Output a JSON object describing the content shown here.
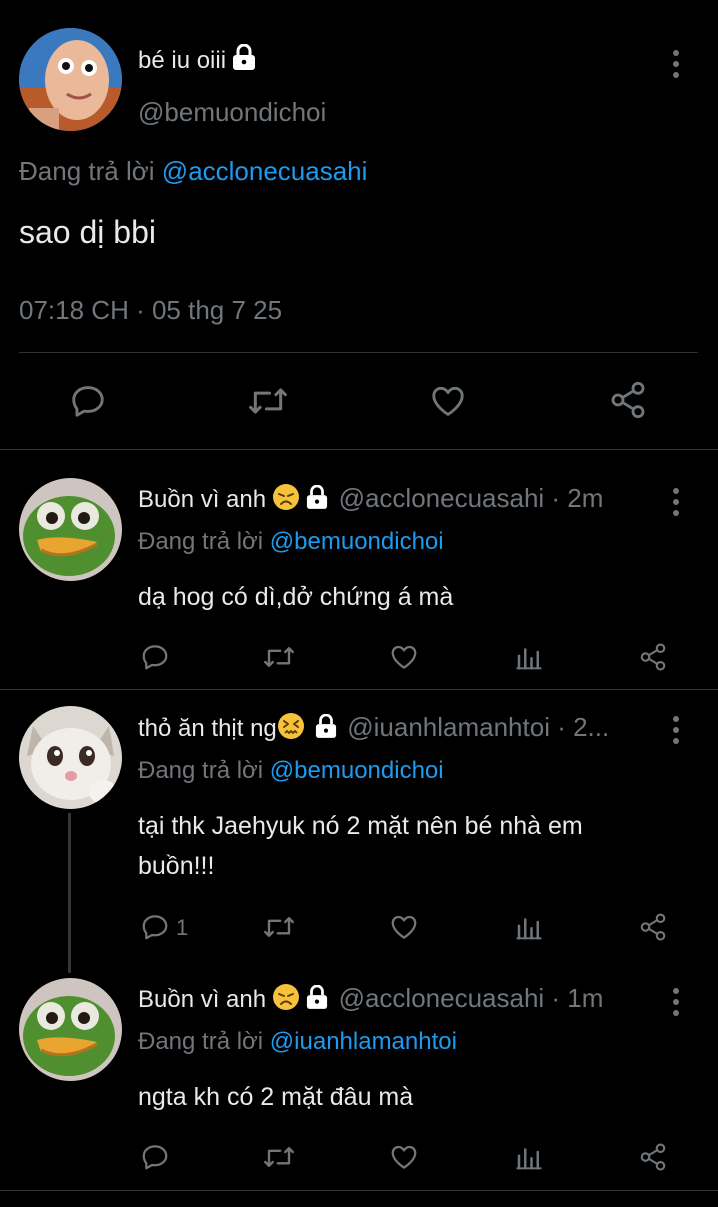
{
  "main_tweet": {
    "author_name": "bé iu oiii",
    "handle": "@bemuondichoi",
    "replying_prefix": "Đang trả lời",
    "replying_to": "@acclonecuasahi",
    "text": "sao dị bbi",
    "timestamp": "07:18 CH · 05 thg 7 25",
    "actions": [
      "reply-icon",
      "retweet-icon",
      "like-icon",
      "share-icon"
    ]
  },
  "replies": [
    {
      "author_name": "Buồn vì anh",
      "handle_time": "@acclonecuasahi · 2m",
      "replying_prefix": "Đang trả lời",
      "replying_to": "@bemuondichoi",
      "text": "dạ hog có dì,dở chứng á mà",
      "reply_count": ""
    },
    {
      "author_name": "thỏ ăn thịt ng",
      "handle_time": "@iuanhlamanhtoi · 2...",
      "replying_prefix": "Đang trả lời",
      "replying_to": "@bemuondichoi",
      "text_line1": "tại thk Jaehyuk nó 2 mặt nên bé nhà em",
      "text_line2": "buồn!!!",
      "reply_count": "1"
    },
    {
      "author_name": "Buồn vì anh",
      "handle_time": "@acclonecuasahi · 1m",
      "replying_prefix": "Đang trả lời",
      "replying_to": "@iuanhlamanhtoi",
      "text": "ngta kh có 2 mặt đâu mà",
      "reply_count": ""
    }
  ],
  "colors": {
    "background": "#000000",
    "text": "#e7e9ea",
    "secondary": "#71767b",
    "link": "#1d9bf0",
    "divider": "#2f3336"
  }
}
